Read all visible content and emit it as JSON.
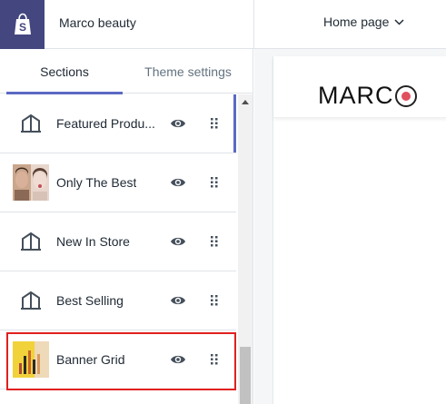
{
  "topbar": {
    "store_name": "Marco beauty",
    "page_select_label": "Home page"
  },
  "tabs": [
    {
      "label": "Sections",
      "active": true
    },
    {
      "label": "Theme settings",
      "active": false
    }
  ],
  "sections": [
    {
      "label": "Featured Produ...",
      "icon": "section-layout-icon"
    },
    {
      "label": "Only The Best",
      "icon": "image-thumbnail"
    },
    {
      "label": "New In Store",
      "icon": "section-layout-icon"
    },
    {
      "label": "Best Selling",
      "icon": "section-layout-icon"
    },
    {
      "label": "Banner Grid",
      "icon": "image-thumbnail"
    }
  ],
  "preview": {
    "brand": "MARC"
  },
  "colors": {
    "logo_bg": "#43467f",
    "accent": "#5c6ac4",
    "highlight": "#e0201f",
    "brand_dot": "#e0505e"
  }
}
